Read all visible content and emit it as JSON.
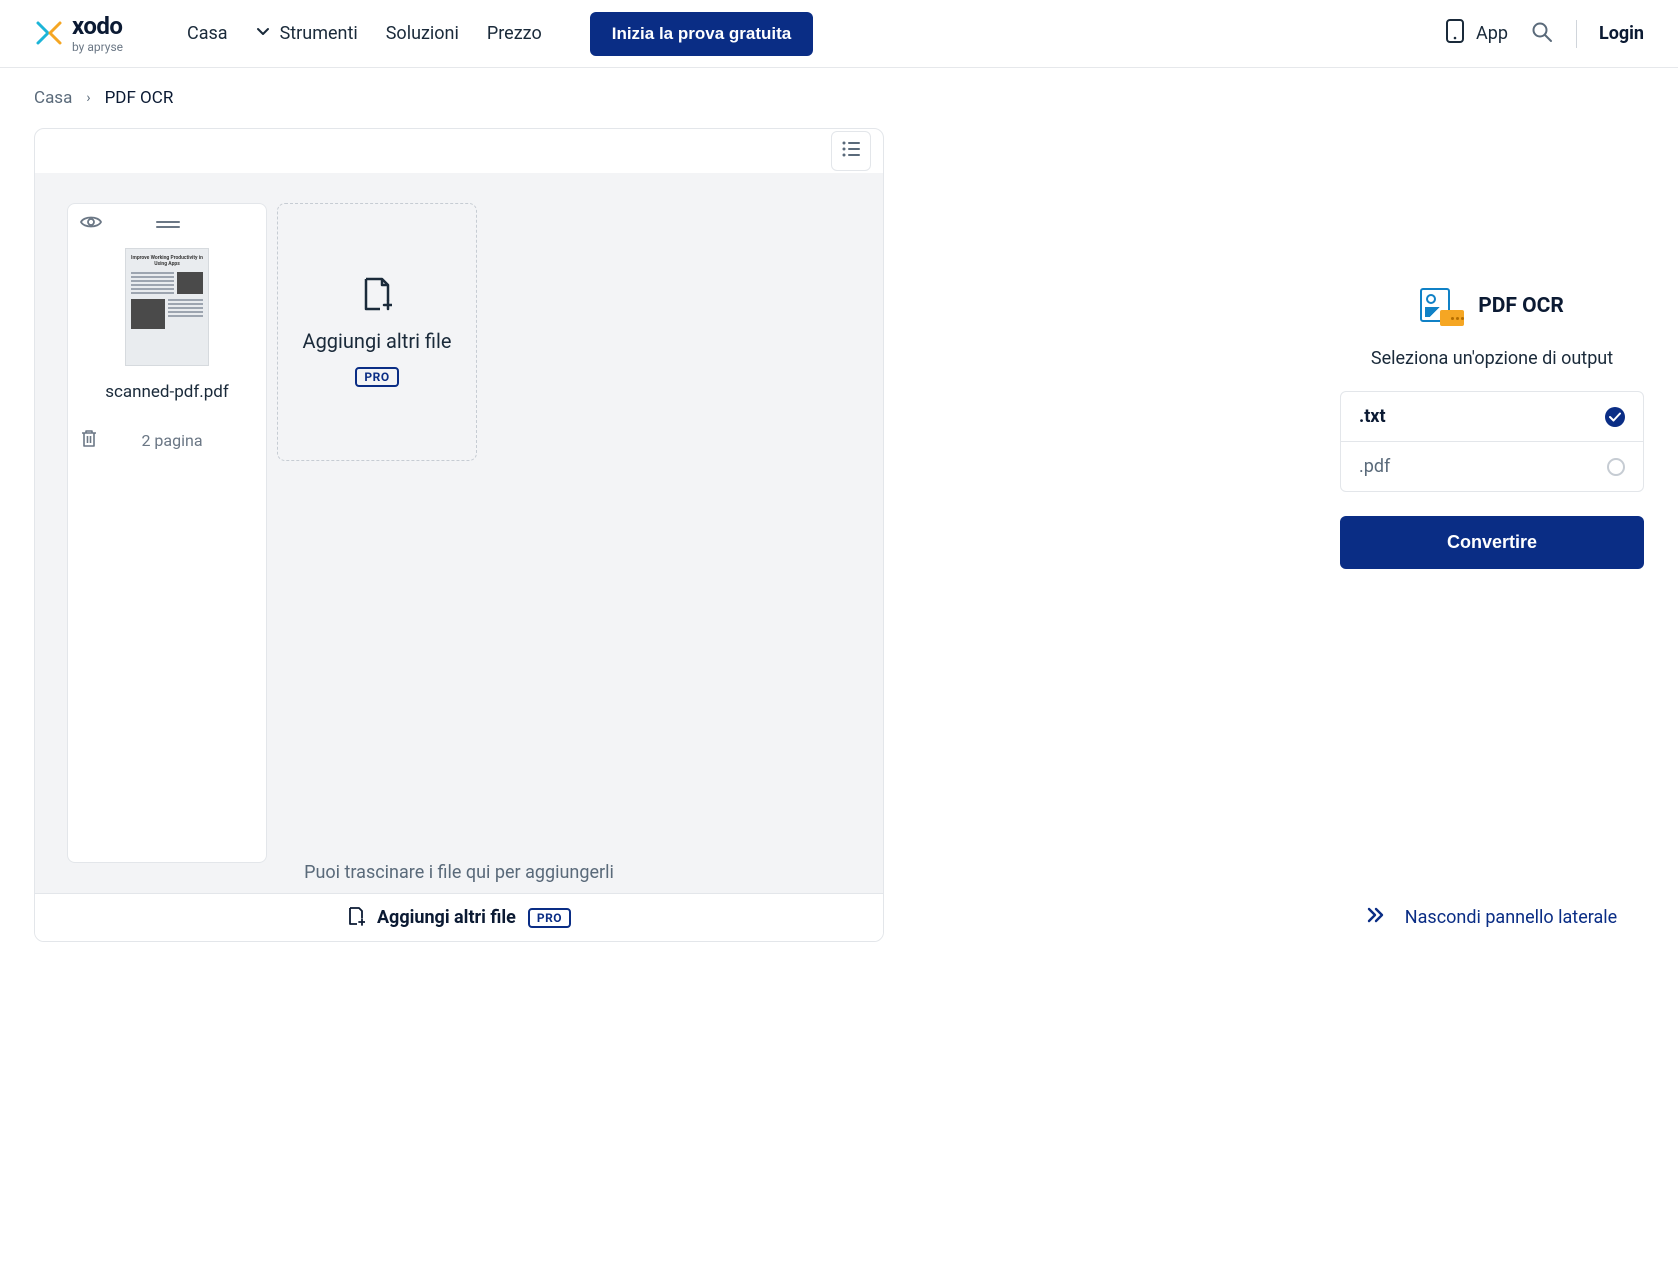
{
  "brand": {
    "name": "xodo",
    "sub": "by apryse"
  },
  "nav": {
    "home": "Casa",
    "tools": "Strumenti",
    "solutions": "Soluzioni",
    "pricing": "Prezzo"
  },
  "cta": "Inizia la prova gratuita",
  "header_right": {
    "app": "App",
    "login": "Login"
  },
  "breadcrumbs": {
    "home": "Casa",
    "current": "PDF OCR"
  },
  "files": [
    {
      "name": "scanned-pdf.pdf",
      "pages_label": "2 pagina"
    }
  ],
  "add_card": {
    "label": "Aggiungi altri file",
    "badge": "PRO"
  },
  "drop_hint": "Puoi trascinare i file qui per aggiungerli",
  "bottom_add": {
    "label": "Aggiungi altri file",
    "badge": "PRO"
  },
  "sidepanel": {
    "title": "PDF OCR",
    "subtitle": "Seleziona un'opzione di output",
    "options": [
      {
        "label": ".txt",
        "selected": true
      },
      {
        "label": ".pdf",
        "selected": false
      }
    ],
    "convert": "Convertire",
    "hide": "Nascondi pannello laterale"
  }
}
